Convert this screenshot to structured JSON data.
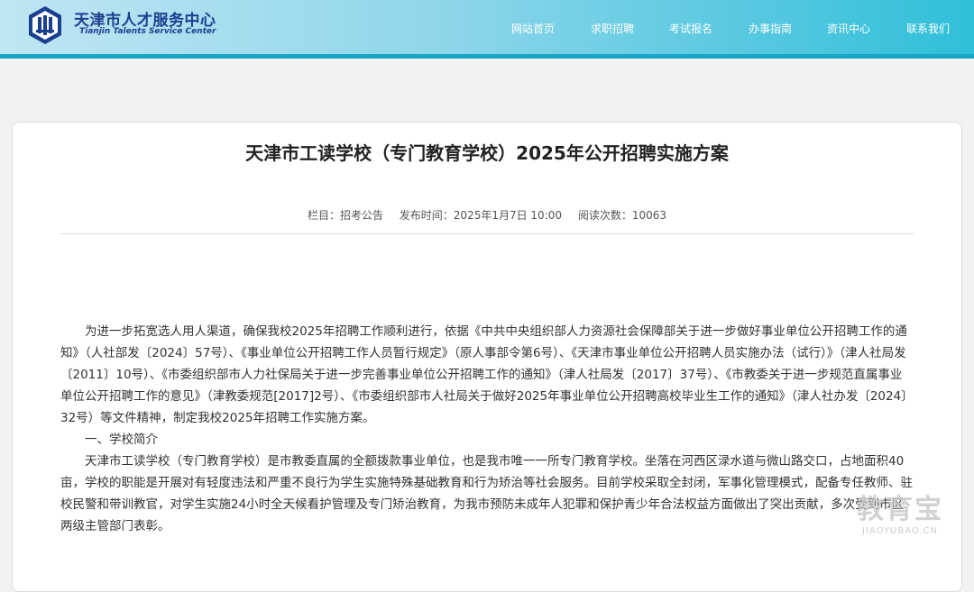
{
  "header": {
    "org_name_cn": "天津市人才服务中心",
    "org_name_en": "Tianjin Talents Service Center",
    "nav": [
      "网站首页",
      "求职招聘",
      "考试报名",
      "办事指南",
      "资讯中心",
      "联系我们"
    ]
  },
  "article": {
    "title": "天津市工读学校（专门教育学校）2025年公开招聘实施方案",
    "meta": {
      "column": "栏目：招考公告",
      "published": "发布时间：2025年1月7日 10:00",
      "views": "阅读次数：10063"
    },
    "paragraphs": [
      "为进一步拓宽选人用人渠道，确保我校2025年招聘工作顺利进行，依据《中共中央组织部人力资源社会保障部关于进一步做好事业单位公开招聘工作的通知》（人社部发〔2024〕57号）、《事业单位公开招聘工作人员暂行规定》（原人事部令第6号）、《天津市事业单位公开招聘人员实施办法（试行）》（津人社局发〔2011〕10号）、《市委组织部市人力社保局关于进一步完善事业单位公开招聘工作的通知》（津人社局发〔2017〕37号）、《市教委关于进一步规范直属事业单位公开招聘工作的意见》（津教委规范[2017]2号）、《市委组织部市人社局关于做好2025年事业单位公开招聘高校毕业生工作的通知》（津人社办发〔2024〕32号）等文件精神，制定我校2025年招聘工作实施方案。",
      "一、学校简介",
      "天津市工读学校（专门教育学校）是市教委直属的全额拨款事业单位，也是我市唯一一所专门教育学校。坐落在河西区渌水道与微山路交口，占地面积40亩，学校的职能是开展对有轻度违法和严重不良行为学生实施特殊基础教育和行为矫治等社会服务。目前学校采取全封闭，军事化管理模式，配备专任教师、驻校民警和带训教官，对学生实施24小时全天候看护管理及专门矫治教育，为我市预防未成年人犯罪和保护青少年合法权益方面做出了突出贡献，多次受到市区两级主管部门表彰。"
    ]
  },
  "watermark": {
    "cn": "教育宝",
    "en": "JIAOYUBAO.CN"
  },
  "colors": {
    "header_gradient_start": "#bfe6f3",
    "header_gradient_end": "#2fbfd9",
    "header_bar": "#1aa6c6",
    "logo_blue": "#1b3f8f"
  }
}
